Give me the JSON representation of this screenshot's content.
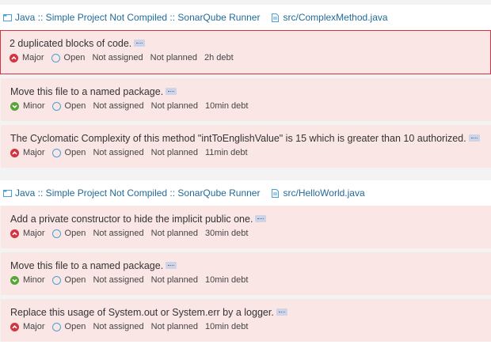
{
  "groups": [
    {
      "project": "Java :: Simple Project Not Compiled :: SonarQube Runner",
      "file": "src/ComplexMethod.java",
      "issues": [
        {
          "message": "2 duplicated blocks of code.",
          "severity": "Major",
          "status": "Open",
          "assignee": "Not assigned",
          "plan": "Not planned",
          "debt": "2h debt"
        },
        {
          "message": "Move this file to a named package.",
          "severity": "Minor",
          "status": "Open",
          "assignee": "Not assigned",
          "plan": "Not planned",
          "debt": "10min debt"
        },
        {
          "message": "The Cyclomatic Complexity of this method \"intToEnglishValue\" is 15 which is greater than 10 authorized.",
          "severity": "Major",
          "status": "Open",
          "assignee": "Not assigned",
          "plan": "Not planned",
          "debt": "11min debt"
        }
      ]
    },
    {
      "project": "Java :: Simple Project Not Compiled :: SonarQube Runner",
      "file": "src/HelloWorld.java",
      "issues": [
        {
          "message": "Add a private constructor to hide the implicit public one.",
          "severity": "Major",
          "status": "Open",
          "assignee": "Not assigned",
          "plan": "Not planned",
          "debt": "30min debt"
        },
        {
          "message": "Move this file to a named package.",
          "severity": "Minor",
          "status": "Open",
          "assignee": "Not assigned",
          "plan": "Not planned",
          "debt": "10min debt"
        },
        {
          "message": "Replace this usage of System.out or System.err by a logger.",
          "severity": "Major",
          "status": "Open",
          "assignee": "Not assigned",
          "plan": "Not planned",
          "debt": "10min debt"
        }
      ]
    }
  ],
  "colors": {
    "link": "#236a97",
    "issue_bg": "#fbe6e6",
    "selected_border": "#d4333f",
    "major": "#d4333f",
    "minor": "#57a43a",
    "open_status": "#4b9fd5"
  },
  "icons": {
    "project": "qualifier-project-icon",
    "file": "qualifier-file-icon",
    "major": "severity-major-icon",
    "minor": "severity-minor-icon",
    "status": "status-open-icon",
    "more": "more-ellipsis-icon"
  }
}
